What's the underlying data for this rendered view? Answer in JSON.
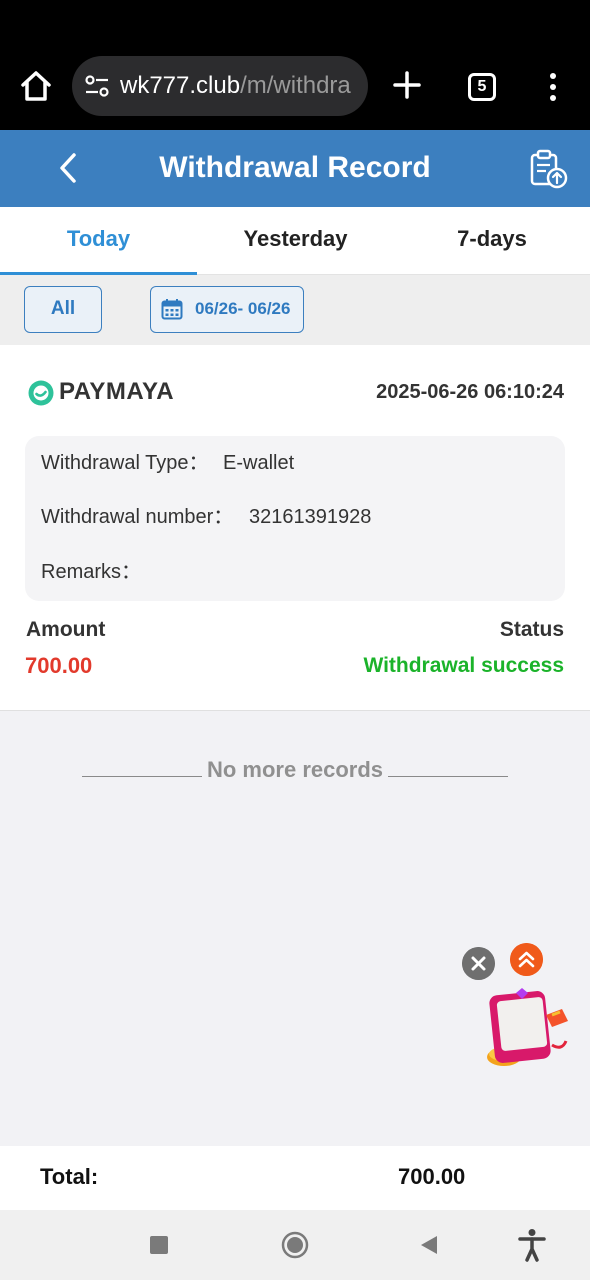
{
  "browser": {
    "url_host": "wk777.club",
    "url_path": "/m/withdra",
    "tab_count": "5",
    "icons": [
      "home-icon",
      "site-settings-icon",
      "new-tab-icon",
      "tab-switcher-icon",
      "overflow-menu-icon"
    ]
  },
  "header": {
    "title": "Withdrawal Record",
    "accent_color": "#3c7fbf"
  },
  "tabs": [
    {
      "label": "Today",
      "active": true
    },
    {
      "label": "Yesterday",
      "active": false
    },
    {
      "label": "7-days",
      "active": false
    }
  ],
  "filter": {
    "all_label": "All",
    "date_range": "06/26- 06/26"
  },
  "record": {
    "method": "PAYMAYA",
    "datetime": "2025-06-26 06:10:24",
    "type_label": "Withdrawal Type：",
    "type_value": "E-wallet",
    "number_label": "Withdrawal number：",
    "number_value": "32161391928",
    "remarks_label": "Remarks：",
    "amount_label": "Amount",
    "amount_value": "700.00",
    "status_label": "Status",
    "status_value": "Withdrawal success",
    "amount_color": "#e23a2c",
    "status_color": "#1bb32a"
  },
  "list_end": "No more records",
  "total": {
    "label": "Total:",
    "value": "700.00"
  }
}
